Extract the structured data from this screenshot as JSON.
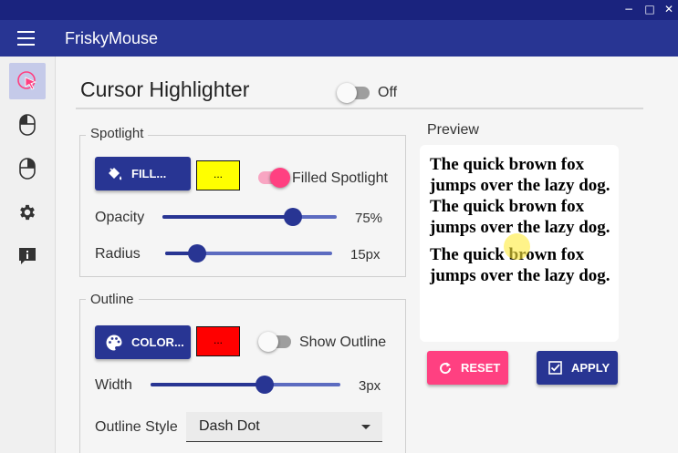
{
  "window": {
    "controls": {
      "minimize": "−",
      "maximize": "□",
      "close": "✕"
    }
  },
  "appbar": {
    "title": "FriskyMouse",
    "menu_icon": "hamburger-icon"
  },
  "sidebar": {
    "items": [
      {
        "name": "cursor-highlighter",
        "icon": "cursor-highlight-icon",
        "active": true
      },
      {
        "name": "left-click",
        "icon": "mouse-left-icon",
        "active": false
      },
      {
        "name": "right-click",
        "icon": "mouse-right-icon",
        "active": false
      },
      {
        "name": "settings",
        "icon": "gear-icon",
        "active": false
      },
      {
        "name": "about",
        "icon": "info-icon",
        "active": false
      }
    ]
  },
  "page": {
    "title": "Cursor Highlighter",
    "enable_toggle": {
      "label": "Off",
      "on": false
    }
  },
  "spotlight": {
    "group_label": "Spotlight",
    "fill_button": "FILL...",
    "fill_swatch": {
      "label": "...",
      "color": "#ffff00"
    },
    "filled_toggle": {
      "label": "Filled Spotlight",
      "on": true
    },
    "opacity": {
      "label": "Opacity",
      "value": 75,
      "display": "75%"
    },
    "radius": {
      "label": "Radius",
      "value": 15,
      "display": "15px",
      "fraction": 0.19
    }
  },
  "outline": {
    "group_label": "Outline",
    "color_button": "COLOR...",
    "color_swatch": {
      "label": "...",
      "color": "#ff0000"
    },
    "show_toggle": {
      "label": "Show Outline",
      "on": false
    },
    "width": {
      "label": "Width",
      "value": 3,
      "display": "3px",
      "fraction": 0.6
    },
    "style": {
      "label": "Outline Style",
      "selected": "Dash Dot"
    }
  },
  "preview": {
    "title": "Preview",
    "lines": [
      "The quick brown fox jumps over the lazy dog.",
      "The quick brown fox jumps over the lazy dog.",
      "The quick brown fox jumps over the lazy dog."
    ]
  },
  "actions": {
    "reset": "RESET",
    "apply": "APPLY"
  },
  "colors": {
    "primary": "#283593",
    "primary_dark": "#1a237e",
    "accent": "#ff4081",
    "highlight": "#ffeb3b"
  }
}
